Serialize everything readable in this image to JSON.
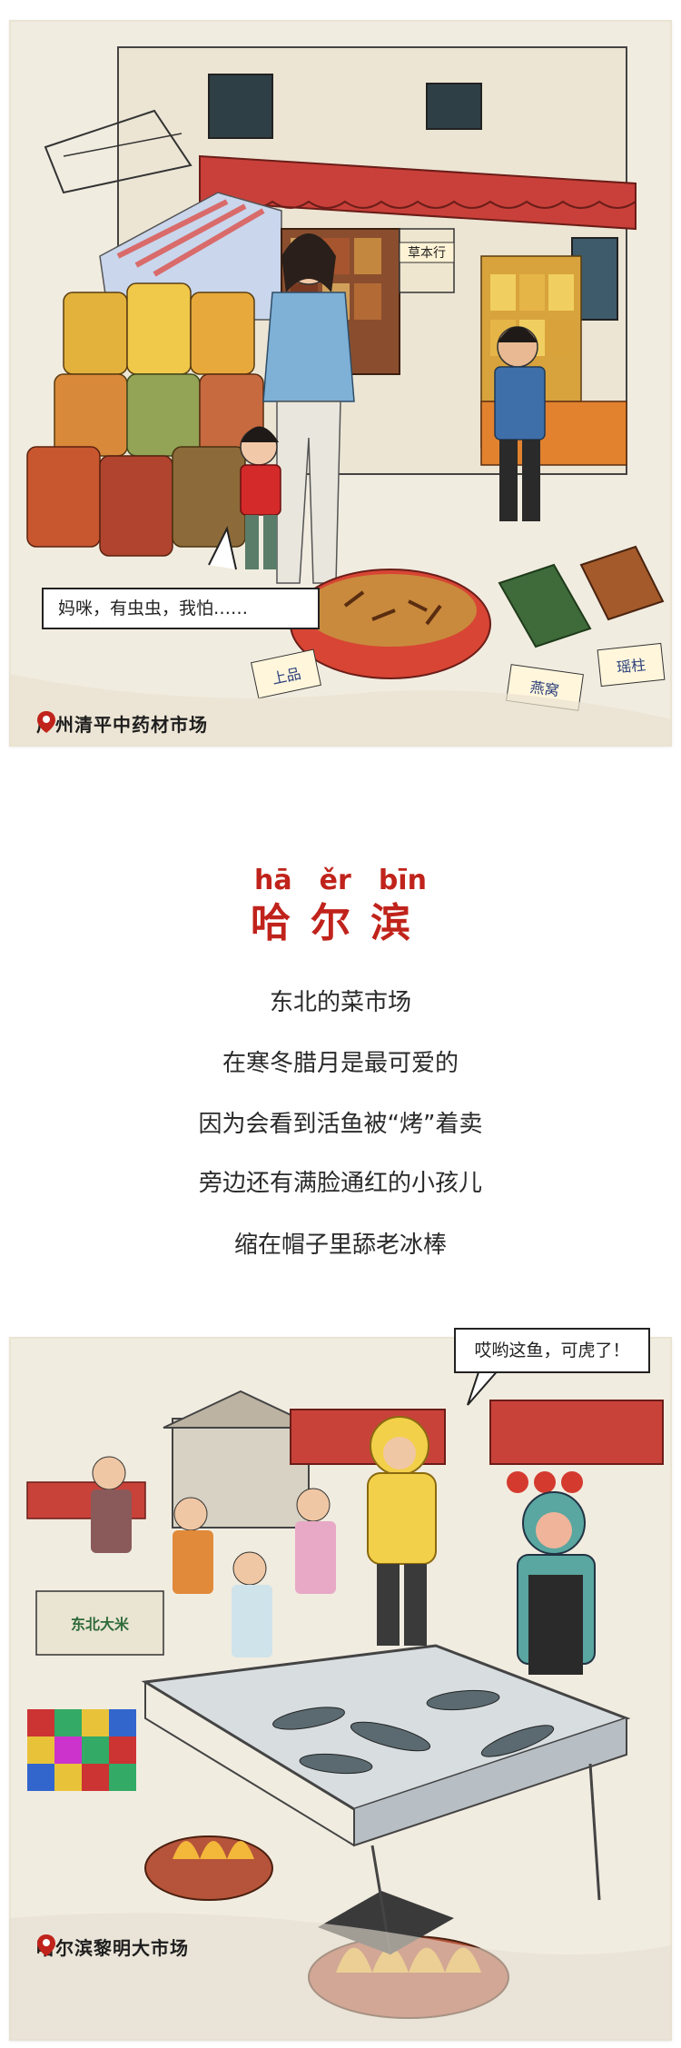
{
  "panel_guangzhou": {
    "speech": "妈咪，有虫虫，我怕……",
    "location": "广州清平中药材市场",
    "sign_text": "草本行",
    "tag_texts": [
      "上品",
      "瑶柱",
      "燕窝"
    ]
  },
  "harbin_section": {
    "pinyin": [
      "hā",
      "ěr",
      "bīn"
    ],
    "title": "哈尔滨",
    "lines": [
      "东北的菜市场",
      "在寒冬腊月是最可爱的",
      "因为会看到活鱼被“烤”着卖",
      "旁边还有满脸通红的小孩儿",
      "缩在帽子里舔老冰棒"
    ]
  },
  "panel_harbin": {
    "speech": "哎哟这鱼，可虎了！",
    "location": "哈尔滨黎明大市场",
    "sign_text": "东北大米"
  },
  "colors": {
    "accent_red": "#c0231b",
    "paper": "#f1ece0"
  }
}
